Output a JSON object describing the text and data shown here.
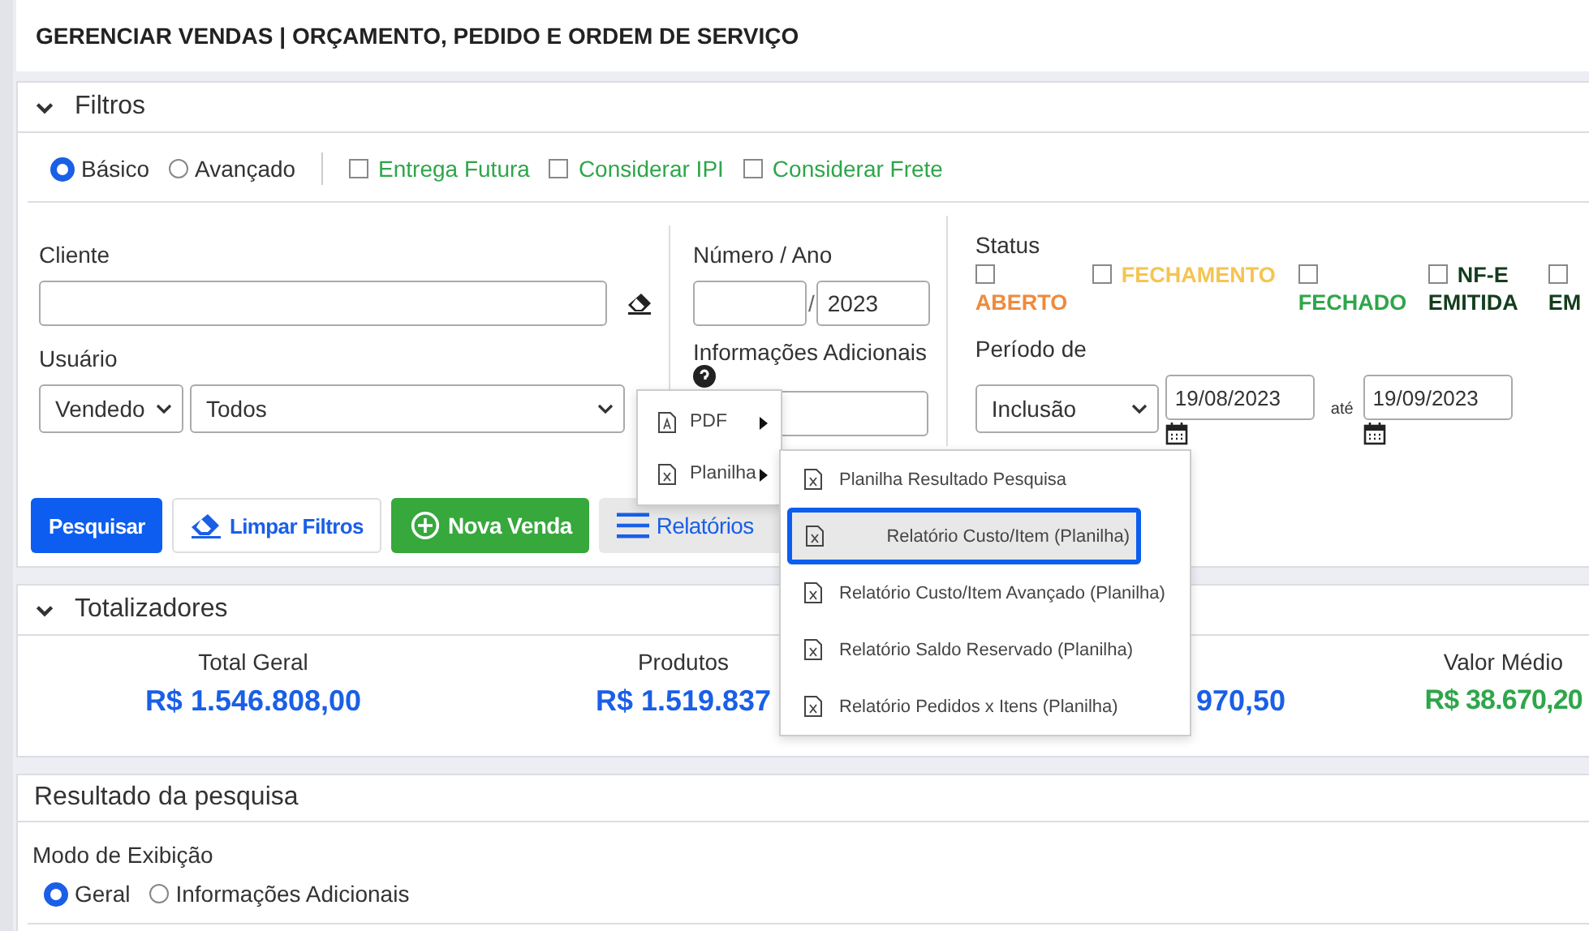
{
  "page_title": "GERENCIAR VENDAS | ORÇAMENTO, PEDIDO E ORDEM DE SERVIÇO",
  "filters": {
    "title": "Filtros",
    "expanded": true,
    "modes": [
      {
        "label": "Básico",
        "selected": true
      },
      {
        "label": "Avançado",
        "selected": false
      }
    ],
    "options": [
      {
        "label": "Entrega Futura",
        "checked": false
      },
      {
        "label": "Considerar IPI",
        "checked": false
      },
      {
        "label": "Considerar Frete",
        "checked": false
      }
    ],
    "cliente": {
      "label": "Cliente"
    },
    "usuario": {
      "label": "Usuário",
      "type_value": "Vendedo",
      "user_value": "Todos"
    },
    "numero_ano": {
      "label": "Número / Ano",
      "separator": "/",
      "year": "2023"
    },
    "info_adicionais": {
      "label": "Informações Adicionais"
    },
    "status": {
      "label": "Status",
      "items": [
        {
          "label": "ABERTO",
          "color": "#ef8a3c",
          "checked": false
        },
        {
          "label": "FECHAMENTO",
          "color": "#f5c451",
          "checked": false
        },
        {
          "label": "FECHADO",
          "color": "#2ea64a",
          "checked": false
        },
        {
          "label": "NF-E EMITIDA",
          "color": "#143d1e",
          "checked": false
        },
        {
          "label": "EM",
          "color": "#143d1e",
          "checked": false
        }
      ]
    },
    "periodo": {
      "label": "Período de",
      "type_value": "Inclusão",
      "from": "19/08/2023",
      "to_label": "até",
      "to": "19/09/2023"
    }
  },
  "actions": [
    {
      "label": "Pesquisar",
      "kind": "primary"
    },
    {
      "label": "Limpar Filtros",
      "kind": "clear"
    },
    {
      "label": "Nova Venda",
      "kind": "new"
    },
    {
      "label": "Relatórios",
      "kind": "menu"
    }
  ],
  "reports_menu": {
    "items": [
      {
        "label": "PDF",
        "kind": "pdf"
      },
      {
        "label": "Planilha",
        "kind": "sheet"
      }
    ],
    "submenu": [
      {
        "label": "Planilha Resultado Pesquisa",
        "selected": false
      },
      {
        "label": "Relatório Custo/Item (Planilha)",
        "selected": true
      },
      {
        "label": "Relatório Custo/Item Avançado (Planilha)",
        "selected": false
      },
      {
        "label": "Relatório Saldo Reservado (Planilha)",
        "selected": false
      },
      {
        "label": "Relatório Pedidos x Itens (Planilha)",
        "selected": false
      }
    ]
  },
  "totals": {
    "title": "Totalizadores",
    "expanded": true,
    "items": [
      {
        "label": "Total Geral",
        "value": "R$ 1.546.808,00",
        "color": "#1a5fe6"
      },
      {
        "label": "Produtos",
        "value": "R$ 1.519.837",
        "color": "#1a5fe6"
      },
      {
        "value": "970,50",
        "color": "#1a5fe6"
      },
      {
        "label": "Valor Médio",
        "value": "R$ 38.670,20",
        "color": "#2ea64a"
      }
    ]
  },
  "results": {
    "title": "Resultado da pesquisa",
    "mode_label": "Modo de Exibição",
    "modes": [
      {
        "label": "Geral",
        "selected": true
      },
      {
        "label": "Informações Adicionais",
        "selected": false
      }
    ]
  }
}
